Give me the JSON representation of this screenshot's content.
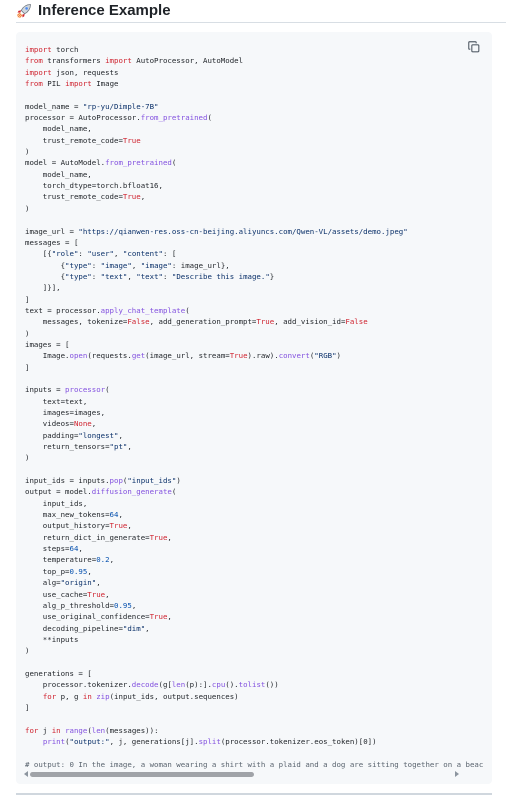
{
  "header": {
    "title": "Inference Example",
    "icon": "rocket-icon"
  },
  "code_block": {
    "copy_icon": "copy-icon",
    "lines": [
      [
        [
          "k",
          "import"
        ],
        [
          "p",
          " torch"
        ]
      ],
      [
        [
          "k",
          "from"
        ],
        [
          "p",
          " transformers "
        ],
        [
          "k",
          "import"
        ],
        [
          "p",
          " AutoProcessor, AutoModel"
        ]
      ],
      [
        [
          "k",
          "import"
        ],
        [
          "p",
          " json, requests"
        ]
      ],
      [
        [
          "k",
          "from"
        ],
        [
          "p",
          " PIL "
        ],
        [
          "k",
          "import"
        ],
        [
          "p",
          " Image"
        ]
      ],
      [],
      [
        [
          "p",
          "model_name = "
        ],
        [
          "s",
          "\"rp-yu/Dimple-7B\""
        ]
      ],
      [
        [
          "p",
          "processor = AutoProcessor."
        ],
        [
          "f",
          "from_pretrained"
        ],
        [
          "p",
          "("
        ]
      ],
      [
        [
          "p",
          "    model_name,"
        ]
      ],
      [
        [
          "p",
          "    trust_remote_code="
        ],
        [
          "k",
          "True"
        ]
      ],
      [
        [
          "p",
          ")"
        ]
      ],
      [
        [
          "p",
          "model = AutoModel."
        ],
        [
          "f",
          "from_pretrained"
        ],
        [
          "p",
          "("
        ]
      ],
      [
        [
          "p",
          "    model_name,"
        ]
      ],
      [
        [
          "p",
          "    torch_dtype=torch.bfloat16,"
        ]
      ],
      [
        [
          "p",
          "    trust_remote_code="
        ],
        [
          "k",
          "True"
        ],
        [
          "p",
          ","
        ]
      ],
      [
        [
          "p",
          ")"
        ]
      ],
      [],
      [
        [
          "p",
          "image_url = "
        ],
        [
          "s",
          "\"https://qianwen-res.oss-cn-beijing.aliyuncs.com/Qwen-VL/assets/demo.jpeg\""
        ]
      ],
      [
        [
          "p",
          "messages = ["
        ]
      ],
      [
        [
          "p",
          "    [{"
        ],
        [
          "s",
          "\"role\""
        ],
        [
          "p",
          ": "
        ],
        [
          "s",
          "\"user\""
        ],
        [
          "p",
          ", "
        ],
        [
          "s",
          "\"content\""
        ],
        [
          "p",
          ": ["
        ]
      ],
      [
        [
          "p",
          "        {"
        ],
        [
          "s",
          "\"type\""
        ],
        [
          "p",
          ": "
        ],
        [
          "s",
          "\"image\""
        ],
        [
          "p",
          ", "
        ],
        [
          "s",
          "\"image\""
        ],
        [
          "p",
          ": image_url},"
        ]
      ],
      [
        [
          "p",
          "        {"
        ],
        [
          "s",
          "\"type\""
        ],
        [
          "p",
          ": "
        ],
        [
          "s",
          "\"text\""
        ],
        [
          "p",
          ", "
        ],
        [
          "s",
          "\"text\""
        ],
        [
          "p",
          ": "
        ],
        [
          "s",
          "\"Describe this image.\""
        ],
        [
          "p",
          "}"
        ]
      ],
      [
        [
          "p",
          "    ]}],"
        ]
      ],
      [
        [
          "p",
          "]"
        ]
      ],
      [
        [
          "p",
          "text = processor."
        ],
        [
          "f",
          "apply_chat_template"
        ],
        [
          "p",
          "("
        ]
      ],
      [
        [
          "p",
          "    messages, tokenize="
        ],
        [
          "k",
          "False"
        ],
        [
          "p",
          ", add_generation_prompt="
        ],
        [
          "k",
          "True"
        ],
        [
          "p",
          ", add_vision_id="
        ],
        [
          "k",
          "False"
        ]
      ],
      [
        [
          "p",
          ")"
        ]
      ],
      [
        [
          "p",
          "images = ["
        ]
      ],
      [
        [
          "p",
          "    Image."
        ],
        [
          "f",
          "open"
        ],
        [
          "p",
          "(requests."
        ],
        [
          "f",
          "get"
        ],
        [
          "p",
          "(image_url, stream="
        ],
        [
          "k",
          "True"
        ],
        [
          "p",
          ").raw)."
        ],
        [
          "f",
          "convert"
        ],
        [
          "p",
          "("
        ],
        [
          "s",
          "\"RGB\""
        ],
        [
          "p",
          ")"
        ]
      ],
      [
        [
          "p",
          "]"
        ]
      ],
      [],
      [
        [
          "p",
          "inputs = "
        ],
        [
          "f",
          "processor"
        ],
        [
          "p",
          "("
        ]
      ],
      [
        [
          "p",
          "    text=text,"
        ]
      ],
      [
        [
          "p",
          "    images=images,"
        ]
      ],
      [
        [
          "p",
          "    videos="
        ],
        [
          "k",
          "None"
        ],
        [
          "p",
          ","
        ]
      ],
      [
        [
          "p",
          "    padding="
        ],
        [
          "s",
          "\"longest\""
        ],
        [
          "p",
          ","
        ]
      ],
      [
        [
          "p",
          "    return_tensors="
        ],
        [
          "s",
          "\"pt\""
        ],
        [
          "p",
          ","
        ]
      ],
      [
        [
          "p",
          ")"
        ]
      ],
      [],
      [
        [
          "p",
          "input_ids = inputs."
        ],
        [
          "f",
          "pop"
        ],
        [
          "p",
          "("
        ],
        [
          "s",
          "\"input_ids\""
        ],
        [
          "p",
          ")"
        ]
      ],
      [
        [
          "p",
          "output = model."
        ],
        [
          "f",
          "diffusion_generate"
        ],
        [
          "p",
          "("
        ]
      ],
      [
        [
          "p",
          "    input_ids,"
        ]
      ],
      [
        [
          "p",
          "    max_new_tokens="
        ],
        [
          "n",
          "64"
        ],
        [
          "p",
          ","
        ]
      ],
      [
        [
          "p",
          "    output_history="
        ],
        [
          "k",
          "True"
        ],
        [
          "p",
          ","
        ]
      ],
      [
        [
          "p",
          "    return_dict_in_generate="
        ],
        [
          "k",
          "True"
        ],
        [
          "p",
          ","
        ]
      ],
      [
        [
          "p",
          "    steps="
        ],
        [
          "n",
          "64"
        ],
        [
          "p",
          ","
        ]
      ],
      [
        [
          "p",
          "    temperature="
        ],
        [
          "n",
          "0.2"
        ],
        [
          "p",
          ","
        ]
      ],
      [
        [
          "p",
          "    top_p="
        ],
        [
          "n",
          "0.95"
        ],
        [
          "p",
          ","
        ]
      ],
      [
        [
          "p",
          "    alg="
        ],
        [
          "s",
          "\"origin\""
        ],
        [
          "p",
          ","
        ]
      ],
      [
        [
          "p",
          "    use_cache="
        ],
        [
          "k",
          "True"
        ],
        [
          "p",
          ","
        ]
      ],
      [
        [
          "p",
          "    alg_p_threshold="
        ],
        [
          "n",
          "0.95"
        ],
        [
          "p",
          ","
        ]
      ],
      [
        [
          "p",
          "    use_original_confidence="
        ],
        [
          "k",
          "True"
        ],
        [
          "p",
          ","
        ]
      ],
      [
        [
          "p",
          "    decoding_pipeline="
        ],
        [
          "s",
          "\"dim\""
        ],
        [
          "p",
          ","
        ]
      ],
      [
        [
          "p",
          "    **inputs"
        ]
      ],
      [
        [
          "p",
          ")"
        ]
      ],
      [],
      [
        [
          "p",
          "generations = ["
        ]
      ],
      [
        [
          "p",
          "    processor.tokenizer."
        ],
        [
          "f",
          "decode"
        ],
        [
          "p",
          "(g["
        ],
        [
          "f",
          "len"
        ],
        [
          "p",
          "(p):]."
        ],
        [
          "f",
          "cpu"
        ],
        [
          "p",
          "()."
        ],
        [
          "f",
          "tolist"
        ],
        [
          "p",
          "())"
        ]
      ],
      [
        [
          "p",
          "    "
        ],
        [
          "k",
          "for"
        ],
        [
          "p",
          " p, g "
        ],
        [
          "k",
          "in"
        ],
        [
          "p",
          " "
        ],
        [
          "f",
          "zip"
        ],
        [
          "p",
          "(input_ids, output.sequences)"
        ]
      ],
      [
        [
          "p",
          "]"
        ]
      ],
      [],
      [
        [
          "k",
          "for"
        ],
        [
          "p",
          " j "
        ],
        [
          "k",
          "in"
        ],
        [
          "p",
          " "
        ],
        [
          "f",
          "range"
        ],
        [
          "p",
          "("
        ],
        [
          "f",
          "len"
        ],
        [
          "p",
          "(messages)):"
        ]
      ],
      [
        [
          "p",
          "    "
        ],
        [
          "f",
          "print"
        ],
        [
          "p",
          "("
        ],
        [
          "s",
          "\"output:\""
        ],
        [
          "p",
          ", j, generations[j]."
        ],
        [
          "f",
          "split"
        ],
        [
          "p",
          "(processor.tokenizer.eos_token)[0])"
        ]
      ],
      [],
      [
        [
          "c",
          "# output: 0 In the image, a woman wearing a shirt with a plaid and a dog are sitting together on a beac"
        ]
      ]
    ]
  },
  "scrollbar": {
    "left_icon": "scroll-left-icon",
    "right_icon": "scroll-right-icon",
    "thumb_fraction": 0.5
  }
}
